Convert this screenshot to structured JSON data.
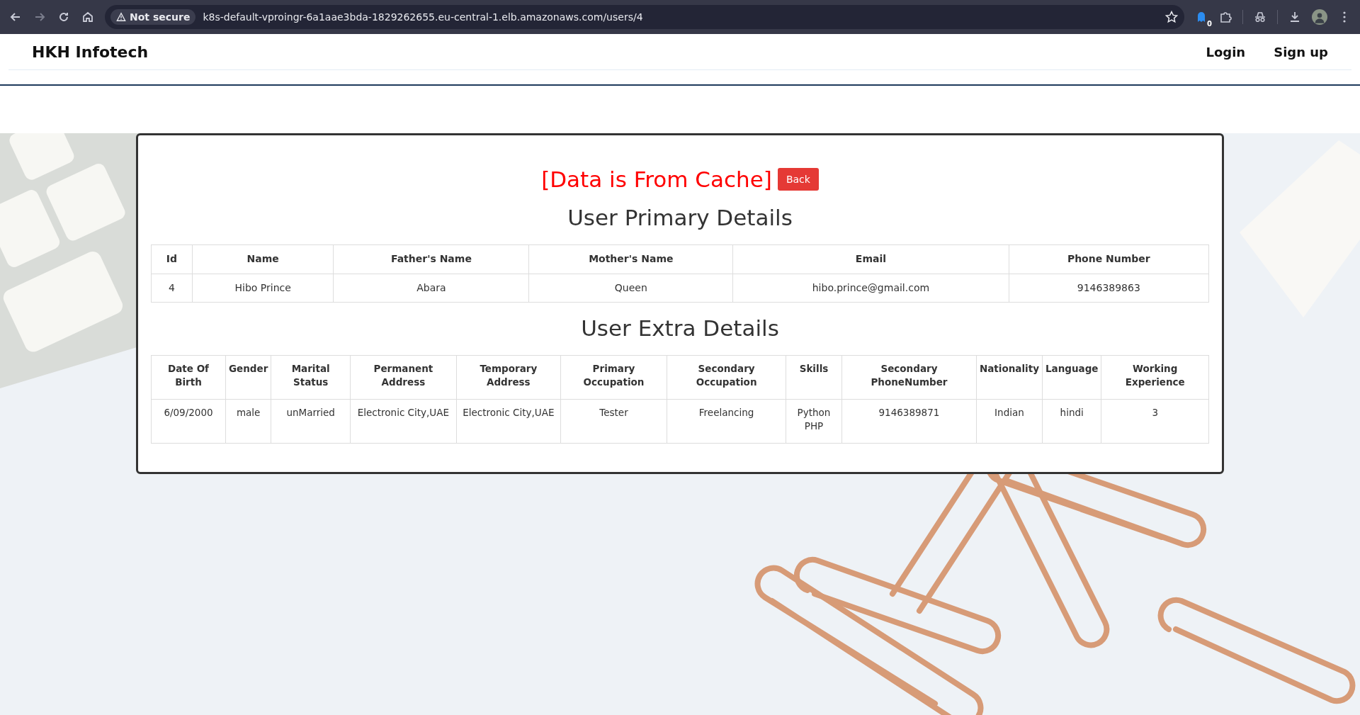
{
  "browser": {
    "security": "Not secure",
    "url": "k8s-default-vproingr-6a1aae3bda-1829262655.eu-central-1.elb.amazonaws.com/users/4",
    "extension_badge": "0"
  },
  "navbar": {
    "brand": "HKH Infotech",
    "links": [
      "Login",
      "Sign up"
    ]
  },
  "notice": "[Data is From Cache]",
  "back_button": "Back",
  "primary": {
    "title": "User Primary Details",
    "columns": [
      "Id",
      "Name",
      "Father's Name",
      "Mother's Name",
      "Email",
      "Phone Number"
    ],
    "rows": [
      [
        "4",
        "Hibo Prince",
        "Abara",
        "Queen",
        "hibo.prince@gmail.com",
        "9146389863"
      ]
    ]
  },
  "extra": {
    "title": "User Extra Details",
    "columns": [
      "Date Of Birth",
      "Gender",
      "Marital Status",
      "Permanent Address",
      "Temporary Address",
      "Primary Occupation",
      "Secondary Occupation",
      "Skills",
      "Secondary PhoneNumber",
      "Nationality",
      "Language",
      "Working Experience"
    ],
    "rows": [
      [
        "6/09/2000",
        "male",
        "unMarried",
        "Electronic City,UAE",
        "Electronic City,UAE",
        "Tester",
        "Freelancing",
        "Python PHP",
        "9146389871",
        "Indian",
        "hindi",
        "3"
      ]
    ]
  }
}
